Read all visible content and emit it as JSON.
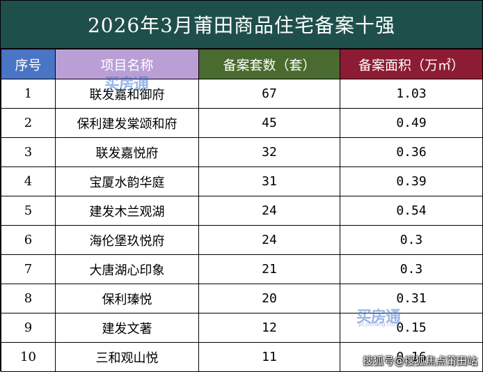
{
  "title": "2026年3月莆田商品住宅备案十强",
  "headers": {
    "rank": "序号",
    "name": "项目名称",
    "units": "备案套数（套）",
    "area": "备案面积（万㎡）"
  },
  "rows": [
    {
      "rank": "1",
      "name": "联发嘉和御府",
      "units": "67",
      "area": "1.03"
    },
    {
      "rank": "2",
      "name": "保利建发棠颂和府",
      "units": "45",
      "area": "0.49"
    },
    {
      "rank": "3",
      "name": "联发嘉悦府",
      "units": "32",
      "area": "0.36"
    },
    {
      "rank": "4",
      "name": "宝厦水韵华庭",
      "units": "31",
      "area": "0.39"
    },
    {
      "rank": "5",
      "name": "建发木兰观湖",
      "units": "24",
      "area": "0.54"
    },
    {
      "rank": "6",
      "name": "海伦堡玖悦府",
      "units": "24",
      "area": "0.3"
    },
    {
      "rank": "7",
      "name": "大唐湖心印象",
      "units": "21",
      "area": "0.3"
    },
    {
      "rank": "8",
      "name": "保利瑧悦",
      "units": "20",
      "area": "0.31"
    },
    {
      "rank": "9",
      "name": "建发文著",
      "units": "12",
      "area": "0.15"
    },
    {
      "rank": "10",
      "name": "三和观山悦",
      "units": "11",
      "area": "0.16"
    }
  ],
  "watermarks": {
    "logo": "买房通",
    "url": "pt.jmfang.com",
    "footer": "搜狐号@搜狐焦点莆田站"
  },
  "colors": {
    "title_bg": "#1f4f4b",
    "header_rank": "#4a74c4",
    "header_name": "#ba9fd6",
    "header_units": "#4a6b2f",
    "header_area": "#8c1c34"
  }
}
